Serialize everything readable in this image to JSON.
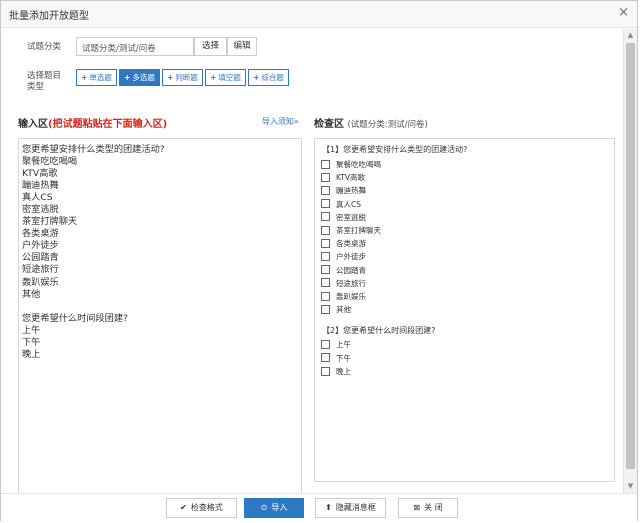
{
  "dialog": {
    "title": "批量添加开放题型",
    "close_glyph": "×"
  },
  "category": {
    "label": "试题分类",
    "path_value": "试题分类/测试/问卷",
    "select_label": "选择",
    "edit_label": "编辑"
  },
  "type_select": {
    "label_line1": "选择题目",
    "label_line2": "类型",
    "buttons": [
      {
        "label": "单选题",
        "active": false
      },
      {
        "label": "多选题",
        "active": true
      },
      {
        "label": "判断题",
        "active": false
      },
      {
        "label": "填空题",
        "active": false
      },
      {
        "label": "综合题",
        "active": false
      }
    ]
  },
  "input_section": {
    "title_prefix": "输入区",
    "title_hint": "(把试题粘贴在下面输入区)",
    "help_link": "导入须知",
    "lines": [
      "您更希望安排什么类型的团建活动?",
      "聚餐吃吃喝喝",
      "KTV高歌",
      "蹦迪热舞",
      "真人CS",
      "密室逃脱",
      "茶室打牌聊天",
      "各类桌游",
      "户外徒步",
      "公园踏青",
      "短途旅行",
      "轰趴娱乐",
      "其他",
      "",
      "您更希望什么时间段团建?",
      "上午",
      "下午",
      "晚上"
    ]
  },
  "check_section": {
    "title": "检查区",
    "subtitle": "(试题分类:测试/问卷)",
    "questions": [
      {
        "title": "【1】您更希望安排什么类型的团建活动?",
        "options": [
          "聚餐吃吃喝喝",
          "KTV高歌",
          "蹦迪热舞",
          "真人CS",
          "密室逃脱",
          "茶室打牌聊天",
          "各类桌游",
          "户外徒步",
          "公园踏青",
          "短途旅行",
          "轰趴娱乐",
          "其他"
        ]
      },
      {
        "title": "【2】您更希望什么时间段团建?",
        "options": [
          "上午",
          "下午",
          "晚上"
        ]
      }
    ]
  },
  "footer": {
    "check_format": "检查格式",
    "import": "导入",
    "hide_messages": "隐藏消息框",
    "close": "关 闭"
  }
}
